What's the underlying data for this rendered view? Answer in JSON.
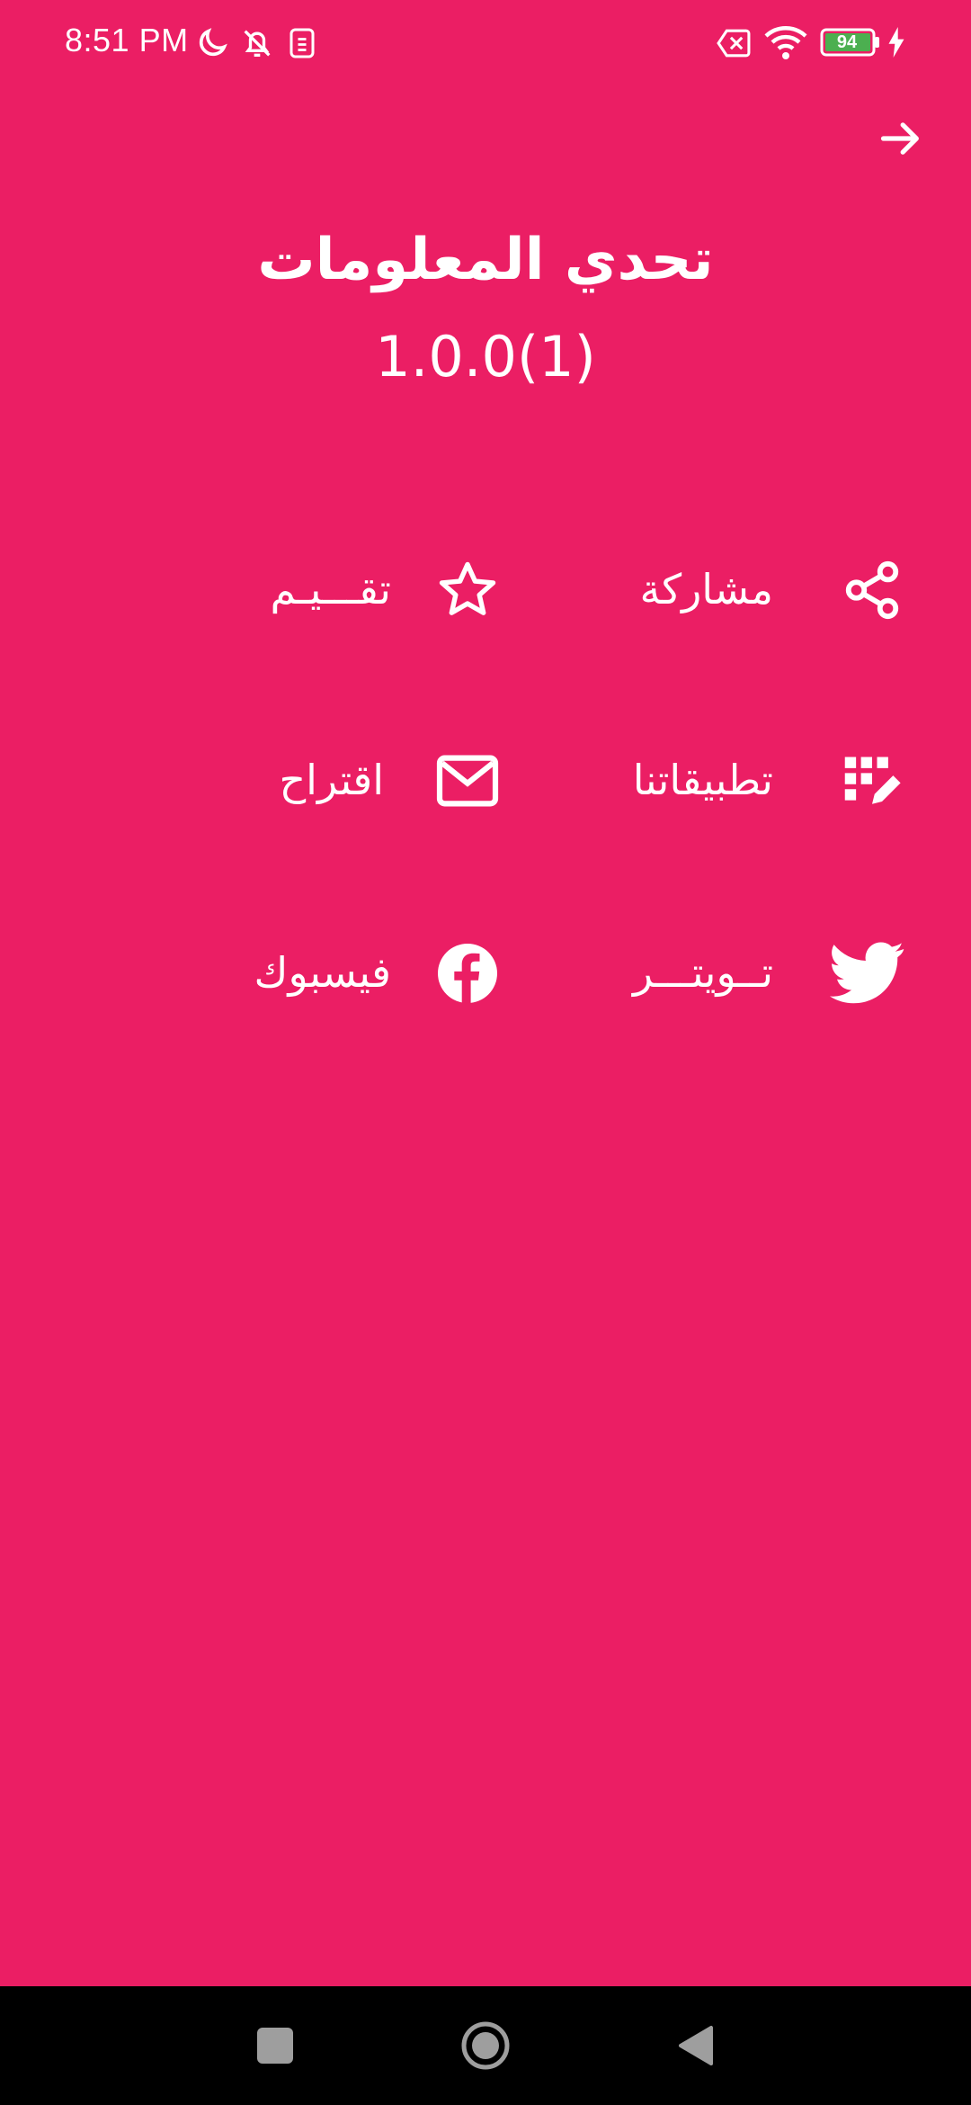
{
  "status_bar": {
    "time": "8:51 PM",
    "icons": [
      "moon-icon",
      "bell-off-icon",
      "sim-icon",
      "no-sim-icon",
      "wifi-icon",
      "battery-icon",
      "charging-icon"
    ],
    "battery_level": "94",
    "battery_color": "#4CAF50"
  },
  "header": {
    "back_icon": "arrow-right-icon"
  },
  "app": {
    "title": "تحدي المعلومات",
    "version": "1.0.0(1)"
  },
  "actions": {
    "share": {
      "label": "مشاركة",
      "icon": "share-icon"
    },
    "rate": {
      "label": "تقـــيـم",
      "icon": "star-outline-icon"
    },
    "our_apps": {
      "label": "تطبيقاتنا",
      "icon": "apps-grid-icon"
    },
    "suggest": {
      "label": "اقتراح",
      "icon": "mail-icon"
    },
    "twitter": {
      "label": "تــويتـــر",
      "icon": "twitter-icon"
    },
    "facebook": {
      "label": "فيسبوك",
      "icon": "facebook-icon"
    }
  },
  "nav_bar": {
    "buttons": [
      "recents-square-icon",
      "home-circle-icon",
      "back-triangle-icon"
    ]
  },
  "colors": {
    "background": "#EB1E64",
    "foreground": "#FFFFFF",
    "nav_background": "#000000"
  }
}
